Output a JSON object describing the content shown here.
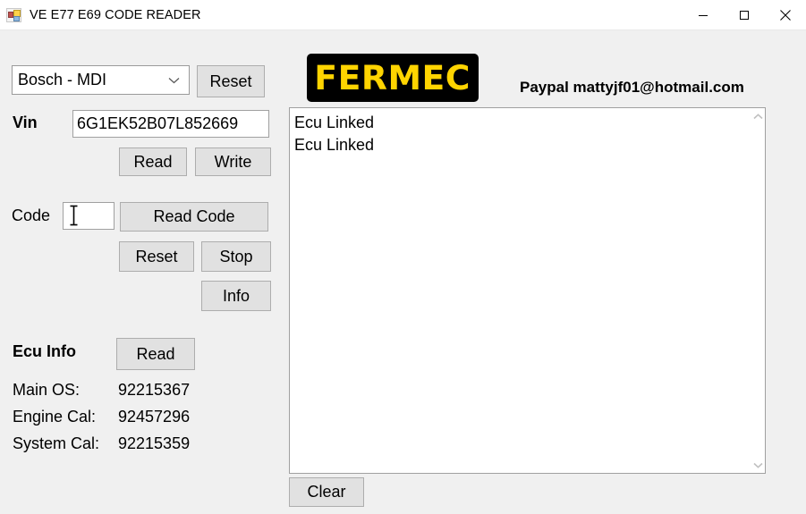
{
  "window": {
    "title": "VE E77 E69 CODE READER",
    "icon": "app-window-icon",
    "controls": {
      "minimize": "minimize-icon",
      "maximize": "maximize-icon",
      "close": "close-icon"
    },
    "background_color": "#f0f0f0"
  },
  "left_panel": {
    "interface_select": {
      "value": "Bosch - MDI",
      "arrow_icon": "chevron-down-icon"
    },
    "reset_top_label": "Reset",
    "vin": {
      "label": "Vin",
      "value": "6G1EK52B07L852669",
      "placeholder": ""
    },
    "read_vin_label": "Read",
    "write_vin_label": "Write",
    "code": {
      "label": "Code",
      "value": "",
      "placeholder": "",
      "cursor_icon": "text-ibeam-cursor"
    },
    "read_code_label": "Read Code",
    "reset_code_label": "Reset",
    "stop_label": "Stop",
    "info_label": "Info",
    "ecu_info": {
      "heading": "Ecu Info",
      "read_label": "Read",
      "rows": [
        {
          "key": "Main OS:",
          "value": "92215367"
        },
        {
          "key": "Engine Cal:",
          "value": "92457296"
        },
        {
          "key": "System Cal:",
          "value": "92215359"
        }
      ]
    }
  },
  "right_panel": {
    "logo": {
      "text": "FERMEC",
      "background_color": "#000000",
      "text_color": "#ffd400"
    },
    "paypal_text": "Paypal mattyjf01@hotmail.com",
    "log": {
      "lines": [
        "Ecu Linked",
        "Ecu Linked"
      ],
      "scrollbar": {
        "up_icon": "chevron-up-icon",
        "down_icon": "chevron-down-icon"
      }
    },
    "clear_label": "Clear"
  }
}
